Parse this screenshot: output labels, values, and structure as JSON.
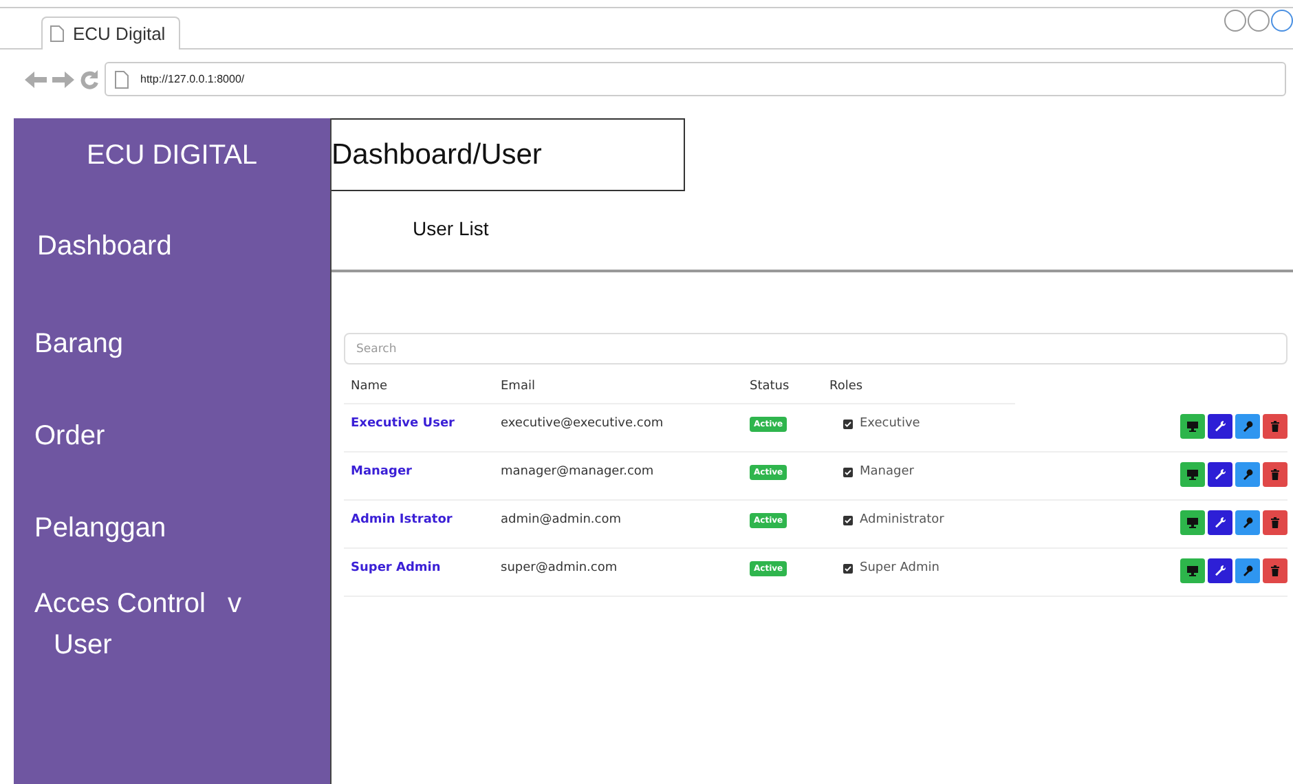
{
  "browser": {
    "tab_title": "ECU Digital",
    "url": "http://127.0.0.1:8000/"
  },
  "sidebar": {
    "brand": "ECU DIGITAL",
    "items": [
      {
        "label": "Dashboard"
      },
      {
        "label": "Barang"
      },
      {
        "label": "Order"
      },
      {
        "label": "Pelanggan"
      },
      {
        "label": "Acces Control",
        "caret": "v",
        "children": [
          {
            "label": "User"
          }
        ]
      }
    ]
  },
  "header": {
    "title": "Dashboard/User",
    "subtitle": "User List"
  },
  "search": {
    "placeholder": "Search"
  },
  "table": {
    "columns": [
      "Name",
      "Email",
      "Status",
      "Roles"
    ],
    "rows": [
      {
        "name": "Executive User",
        "email": "executive@executive.com",
        "status": "Active",
        "role": "Executive",
        "role_checked": true,
        "actions": [
          {
            "kind": "monitor",
            "color": "#2db54b"
          },
          {
            "kind": "wrench",
            "color": "#2d1fd6"
          },
          {
            "kind": "key",
            "color": "#2f96f0"
          },
          {
            "kind": "trash",
            "color": "#e04848"
          }
        ]
      },
      {
        "name": "Manager",
        "email": "manager@manager.com",
        "status": "Active",
        "role": "Manager",
        "role_checked": true,
        "actions": [
          {
            "kind": "monitor",
            "color": "#2db54b"
          },
          {
            "kind": "wrench",
            "color": "#2d1fd6"
          },
          {
            "kind": "key",
            "color": "#2f96f0"
          },
          {
            "kind": "trash",
            "color": "#e04848"
          }
        ]
      },
      {
        "name": "Admin Istrator",
        "email": "admin@admin.com",
        "status": "Active",
        "role": "Administrator",
        "role_checked": true,
        "actions": [
          {
            "kind": "monitor",
            "color": "#2db54b"
          },
          {
            "kind": "wrench",
            "color": "#2d1fd6"
          },
          {
            "kind": "key",
            "color": "#2f96f0"
          },
          {
            "kind": "trash",
            "color": "#e04848"
          }
        ]
      },
      {
        "name": "Super Admin",
        "email": "super@admin.com",
        "status": "Active",
        "role": "Super Admin",
        "role_checked": true,
        "actions": [
          {
            "kind": "monitor",
            "color": "#2db54b"
          },
          {
            "kind": "wrench",
            "color": "#2d1fd6"
          },
          {
            "kind": "key",
            "color": "#2f96f0"
          },
          {
            "kind": "trash",
            "color": "#e04848"
          }
        ]
      }
    ]
  }
}
